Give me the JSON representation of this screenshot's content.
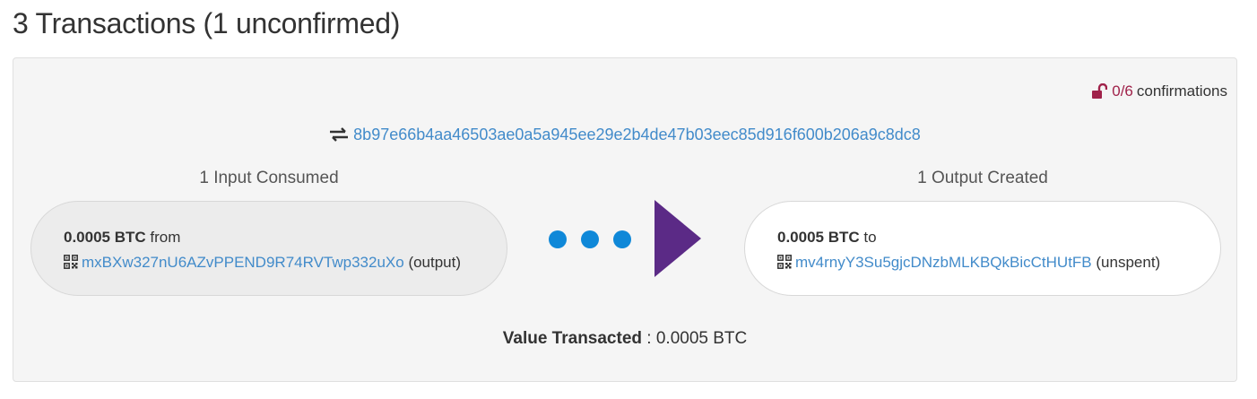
{
  "page": {
    "title": "3 Transactions (1 unconfirmed)"
  },
  "transaction": {
    "confirmations_count": "0/6",
    "confirmations_label": "confirmations",
    "txid": "8b97e66b4aa46503ae0a5a945ee29e2b4de47b03eec85d916f600b206a9c8dc8",
    "inputs_label": "1 Input Consumed",
    "outputs_label": "1 Output Created",
    "input": {
      "amount": "0.0005 BTC",
      "direction": "from",
      "address": "mxBXw327nU6AZvPPEND9R74RVTwp332uXo",
      "suffix": "(output)"
    },
    "output": {
      "amount": "0.0005 BTC",
      "direction": "to",
      "address": "mv4rnyY3Su5gjcDNzbMLKBQkBicCtHUtFB",
      "status": "(unspent)"
    },
    "value_label": "Value Transacted",
    "value_sep": " : ",
    "value": "0.0005 BTC"
  },
  "colors": {
    "link": "#428bca",
    "unconfirmed_lock": "#a0224a",
    "flow_dots": "#0f88d8",
    "flow_arrow": "#5b2a86"
  },
  "icons": {
    "confirmations": "unlocked-padlock-icon",
    "txid": "exchange-arrows-icon",
    "address": "qr-code-icon",
    "flow": "play-arrow-icon"
  }
}
